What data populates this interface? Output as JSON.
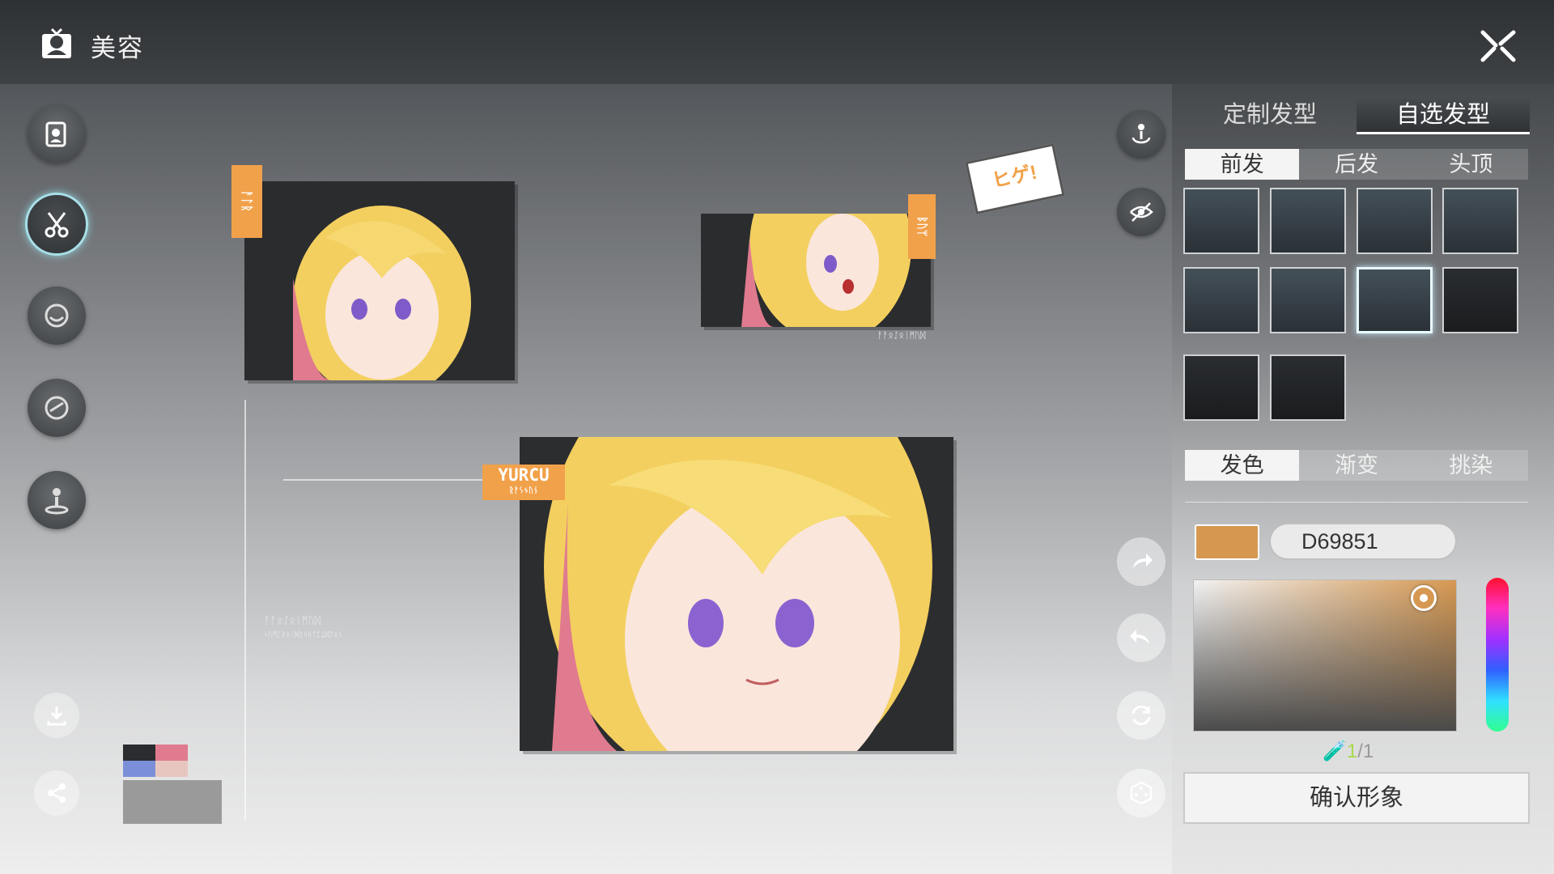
{
  "header": {
    "title": "美容"
  },
  "stage": {
    "tag_top_left": "ᚨᛚᚱ",
    "tag_top_right": "ᛒᚢᛘ",
    "tag_main": "YURCU",
    "tag_main_sub": "ᚱᚨᛊᛃᚢᚾ",
    "speech_bubble": "ヒゲ!",
    "deco_text_1": "ᚨᚨᛟᛇᛟᛁᛗᚢᛞ",
    "deco_text_2": "ᛃᚢᛗᛈᚱᛟᛁᛞᚱᛋᚺᛏᛈᛦᛞᛉᛟᚾ"
  },
  "side_panel": {
    "top_tabs": [
      {
        "label": "定制发型"
      },
      {
        "label": "自选发型",
        "active": true
      }
    ],
    "sub_tabs": [
      {
        "label": "前发",
        "active": true
      },
      {
        "label": "后发"
      },
      {
        "label": "头顶"
      }
    ],
    "hair_styles": [
      {
        "name": "hair-style-1"
      },
      {
        "name": "hair-style-2"
      },
      {
        "name": "hair-style-3"
      },
      {
        "name": "hair-style-4"
      },
      {
        "name": "hair-style-5"
      },
      {
        "name": "hair-style-6"
      },
      {
        "name": "hair-style-7",
        "selected": true
      },
      {
        "name": "hair-style-8"
      },
      {
        "name": "hair-style-9"
      },
      {
        "name": "hair-style-10"
      }
    ],
    "color_tabs": [
      {
        "label": "发色",
        "active": true
      },
      {
        "label": "渐变"
      },
      {
        "label": "挑染"
      }
    ],
    "hex_value": "D69851",
    "current_color": "#d69851",
    "count_current": "1",
    "count_total": "/1",
    "confirm_label": "确认形象"
  },
  "left_rail_icons": [
    "face-card-icon",
    "scissors-icon",
    "makeup-icon",
    "eye-icon",
    "pose-icon"
  ],
  "colors": {
    "accent_orange": "#f1a14a",
    "active_glow": "#a8dfe8"
  }
}
